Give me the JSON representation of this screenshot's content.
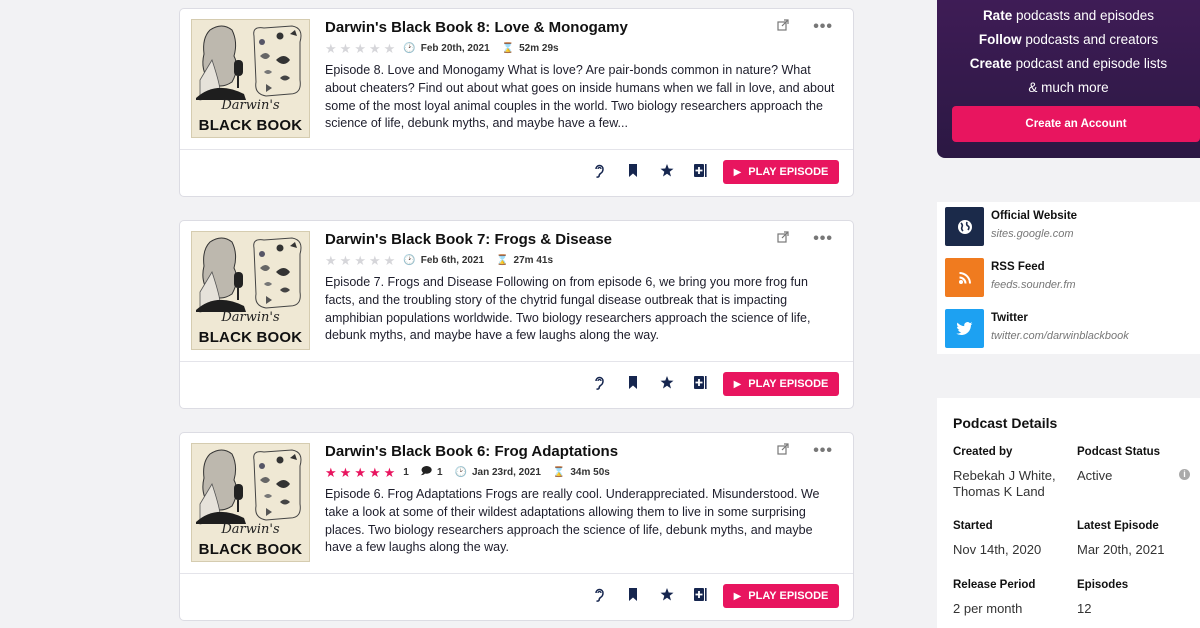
{
  "episodes": [
    {
      "title": "Darwin's Black Book 8: Love & Monogamy",
      "rating": 0,
      "rating_count": "",
      "comments": "",
      "date": "Feb 20th, 2021",
      "duration": "52m 29s",
      "description": "Episode 8. Love and Monogamy What is love? Are pair-bonds common in nature? What about cheaters? Find out about what goes on inside humans when we fall in love, and about some of the most loyal animal couples in the world. Two biology researchers approach the science of life, debunk myths, and maybe have a few...",
      "cover_title": "Darwin's",
      "cover_subtitle": "BLACK BOOK",
      "play_label": "PLAY EPISODE"
    },
    {
      "title": "Darwin's Black Book 7: Frogs & Disease",
      "rating": 0,
      "rating_count": "",
      "comments": "",
      "date": "Feb 6th, 2021",
      "duration": "27m 41s",
      "description": "Episode 7. Frogs and Disease Following on from episode 6, we bring you more frog fun facts, and the troubling story of the chytrid fungal disease outbreak that is impacting amphibian populations worldwide. Two biology researchers approach the science of life, debunk myths, and maybe have a few laughs along the way.",
      "cover_title": "Darwin's",
      "cover_subtitle": "BLACK BOOK",
      "play_label": "PLAY EPISODE"
    },
    {
      "title": "Darwin's Black Book 6: Frog Adaptations",
      "rating": 5,
      "rating_count": "1",
      "comments": "1",
      "date": "Jan 23rd, 2021",
      "duration": "34m 50s",
      "description": "Episode 6. Frog Adaptations Frogs are really cool. Underappreciated. Misunderstood. We take a look at some of their wildest adaptations allowing them to live in some surprising places. Two biology researchers approach the science of life, debunk myths, and maybe have a few laughs along the way.",
      "cover_title": "Darwin's",
      "cover_subtitle": "BLACK BOOK",
      "play_label": "PLAY EPISODE"
    }
  ],
  "promo": {
    "line1_bold": "Rate",
    "line1_rest": " podcasts and episodes",
    "line2_bold": "Follow",
    "line2_rest": " podcasts and creators",
    "line3_bold": "Create",
    "line3_rest": " podcast and episode lists",
    "line4": "& much more",
    "cta": "Create an Account"
  },
  "links": [
    {
      "label": "Official Website",
      "sub": "sites.google.com",
      "color": "#1b2a4a",
      "icon": "globe-icon"
    },
    {
      "label": "RSS Feed",
      "sub": "feeds.sounder.fm",
      "color": "#f07b1f",
      "icon": "rss-icon"
    },
    {
      "label": "Twitter",
      "sub": "twitter.com/darwinblackbook",
      "color": "#1da1f2",
      "icon": "twitter-icon"
    }
  ],
  "details": {
    "title": "Podcast Details",
    "created_by_label": "Created by",
    "created_by_line1": "Rebekah J White,",
    "created_by_line2": "Thomas K Land",
    "status_label": "Podcast Status",
    "status_value": "Active",
    "started_label": "Started",
    "started_value": "Nov 14th, 2020",
    "latest_label": "Latest Episode",
    "latest_value": "Mar 20th, 2021",
    "release_label": "Release Period",
    "release_value": "2 per month",
    "episodes_label": "Episodes",
    "episodes_value": "12"
  },
  "colors": {
    "accent": "#e8155f",
    "navy": "#16264f",
    "promo_bg": "#3f1c56"
  }
}
